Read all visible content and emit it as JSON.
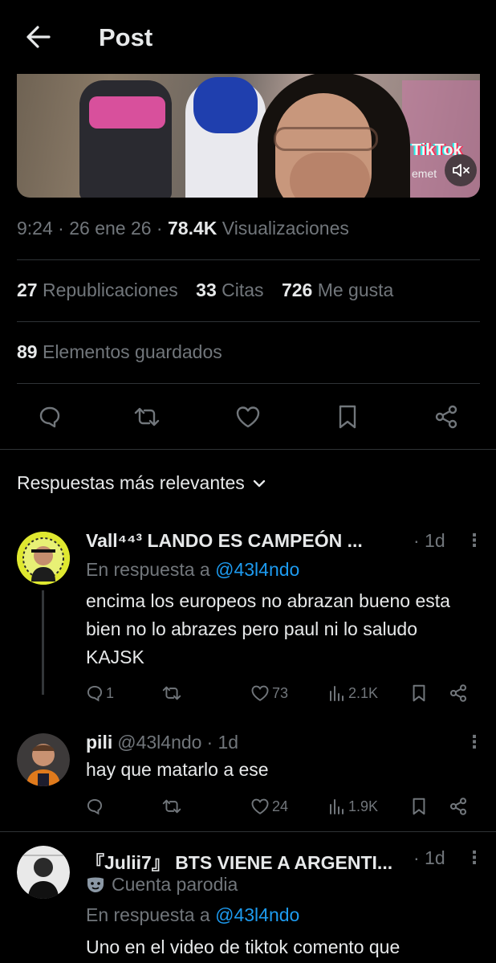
{
  "header": {
    "title": "Post",
    "back_icon": "arrow-left-icon"
  },
  "media": {
    "watermark": "TikTok",
    "watermark_user": "emet",
    "mute_icon": "speaker-muted-icon"
  },
  "post_meta": {
    "time": "9:24",
    "sep1": " · ",
    "date": "26 ene 26",
    "sep2": " · ",
    "views_count": "78.4K",
    "views_label": "Visualizaciones"
  },
  "stats": {
    "reposts_count": "27",
    "reposts_label": "Republicaciones",
    "quotes_count": "33",
    "quotes_label": "Citas",
    "likes_count": "726",
    "likes_label": "Me gusta",
    "bookmarks_count": "89",
    "bookmarks_label": "Elementos guardados"
  },
  "actions": [
    "reply-icon",
    "repost-icon",
    "like-icon",
    "bookmark-icon",
    "share-icon"
  ],
  "sort": {
    "label": "Respuestas más relevantes"
  },
  "replies": [
    {
      "name": "Vall⁴⁴³ LANDO ES CAMPEÓN ...",
      "time": "· 1d",
      "reply_to_label": "En respuesta a",
      "reply_to_handle": "@43l4ndo",
      "text": "encima los europeos no abrazan bueno esta bien no lo abrazes pero paul ni lo saludo KAJSK",
      "replies": "1",
      "reposts": "",
      "likes": "73",
      "views": "2.1K"
    },
    {
      "name": "pili",
      "handle": "@43l4ndo",
      "time": "· 1d",
      "text": "hay que matarlo a ese",
      "replies": "",
      "reposts": "",
      "likes": "24",
      "views": "1.9K"
    },
    {
      "name": "『Julii7』 BTS VIENE A ARGENTI...",
      "time": "· 1d",
      "badge": "Cuenta parodia",
      "reply_to_label": "En respuesta a",
      "reply_to_handle": "@43l4ndo",
      "text": "Uno en el video de tiktok comento que"
    }
  ],
  "more_label": "⋮",
  "colors": {
    "background": "#000000",
    "text": "#e7e9ea",
    "muted": "#71767b",
    "accent": "#1d9bf0",
    "divider": "#2f3336"
  }
}
